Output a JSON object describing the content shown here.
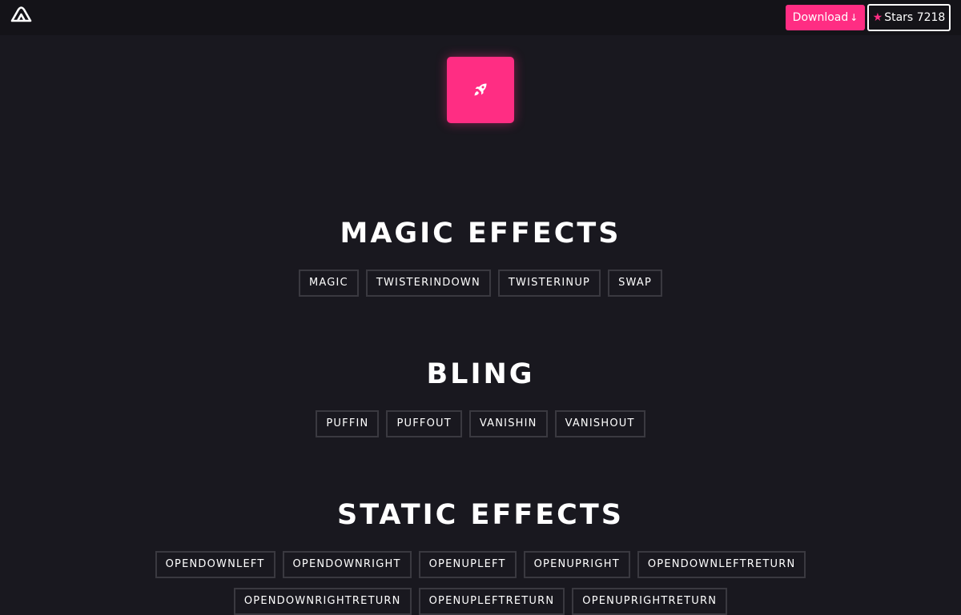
{
  "header": {
    "logo_icon": "mountain-logo-icon",
    "download_label": "Download",
    "download_icon": "arrow-down-icon",
    "stars_label": "Stars",
    "stars_count": "7218",
    "star_icon": "star-icon",
    "accent_color": "#ff2d83"
  },
  "demo": {
    "icon": "rocket-icon"
  },
  "sections": [
    {
      "title": "MAGIC EFFECTS",
      "rows": [
        [
          "MAGIC",
          "TWISTERINDOWN",
          "TWISTERINUP",
          "SWAP"
        ]
      ]
    },
    {
      "title": "BLING",
      "rows": [
        [
          "PUFFIN",
          "PUFFOUT",
          "VANISHIN",
          "VANISHOUT"
        ]
      ]
    },
    {
      "title": "STATIC EFFECTS",
      "rows": [
        [
          "OPENDOWNLEFT",
          "OPENDOWNRIGHT",
          "OPENUPLEFT",
          "OPENUPRIGHT",
          "OPENDOWNLEFTRETURN"
        ],
        [
          "OPENDOWNRIGHTRETURN",
          "OPENUPLEFTRETURN",
          "OPENUPRIGHTRETURN"
        ]
      ]
    }
  ]
}
